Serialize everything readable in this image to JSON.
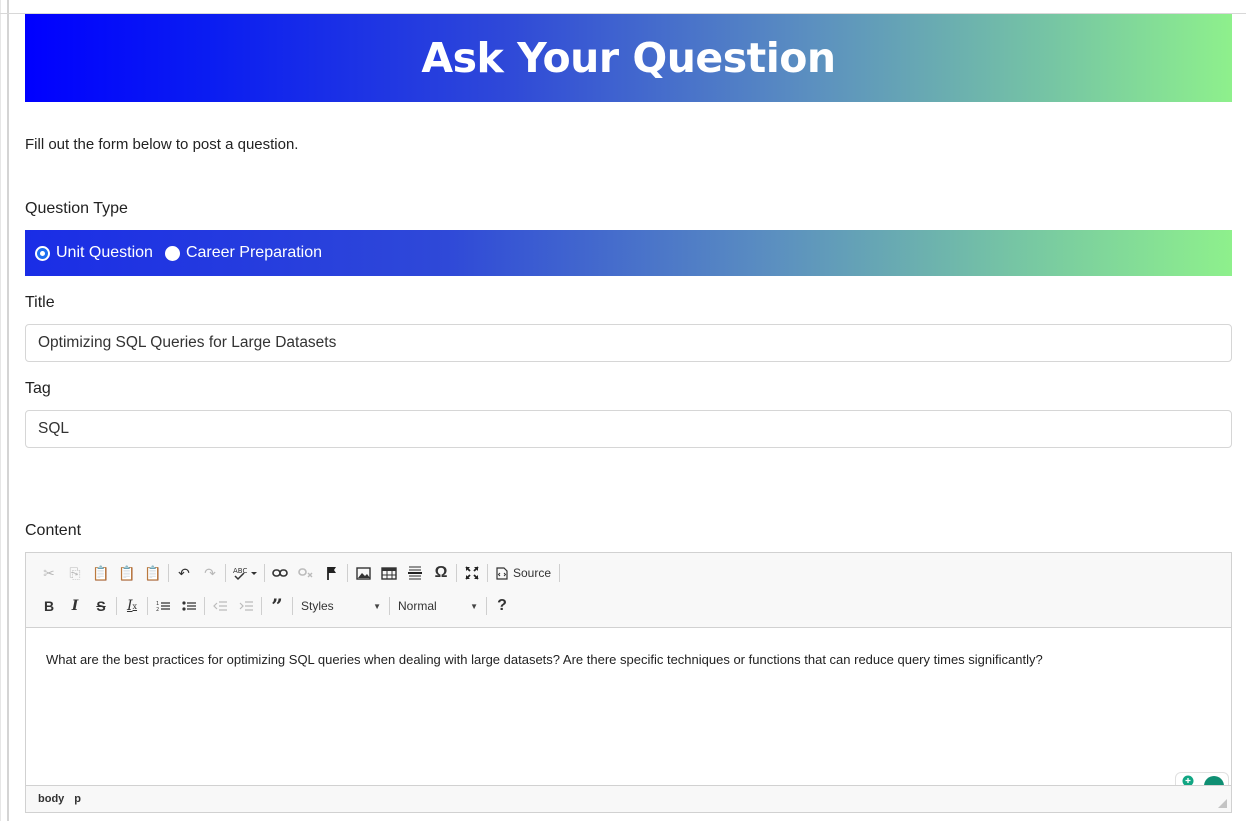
{
  "header": {
    "title": "Ask Your Question"
  },
  "intro": "Fill out the form below to post a question.",
  "question_type": {
    "label": "Question Type",
    "options": [
      {
        "label": "Unit Question",
        "checked": true
      },
      {
        "label": "Career Preparation",
        "checked": false
      }
    ]
  },
  "title_field": {
    "label": "Title",
    "value": "Optimizing SQL Queries for Large Datasets"
  },
  "tag_field": {
    "label": "Tag",
    "value": "SQL"
  },
  "content": {
    "label": "Content",
    "toolbar": {
      "source_label": "Source",
      "styles_label": "Styles",
      "format_label": "Normal",
      "help_label": "?"
    },
    "body_text": "What are the best practices for optimizing SQL queries when dealing with large datasets? Are there specific techniques or functions that can reduce query times significantly?",
    "path": [
      "body",
      "p"
    ]
  },
  "colors": {
    "gradient_start": "#0000ff",
    "gradient_end": "#8ef08c"
  }
}
